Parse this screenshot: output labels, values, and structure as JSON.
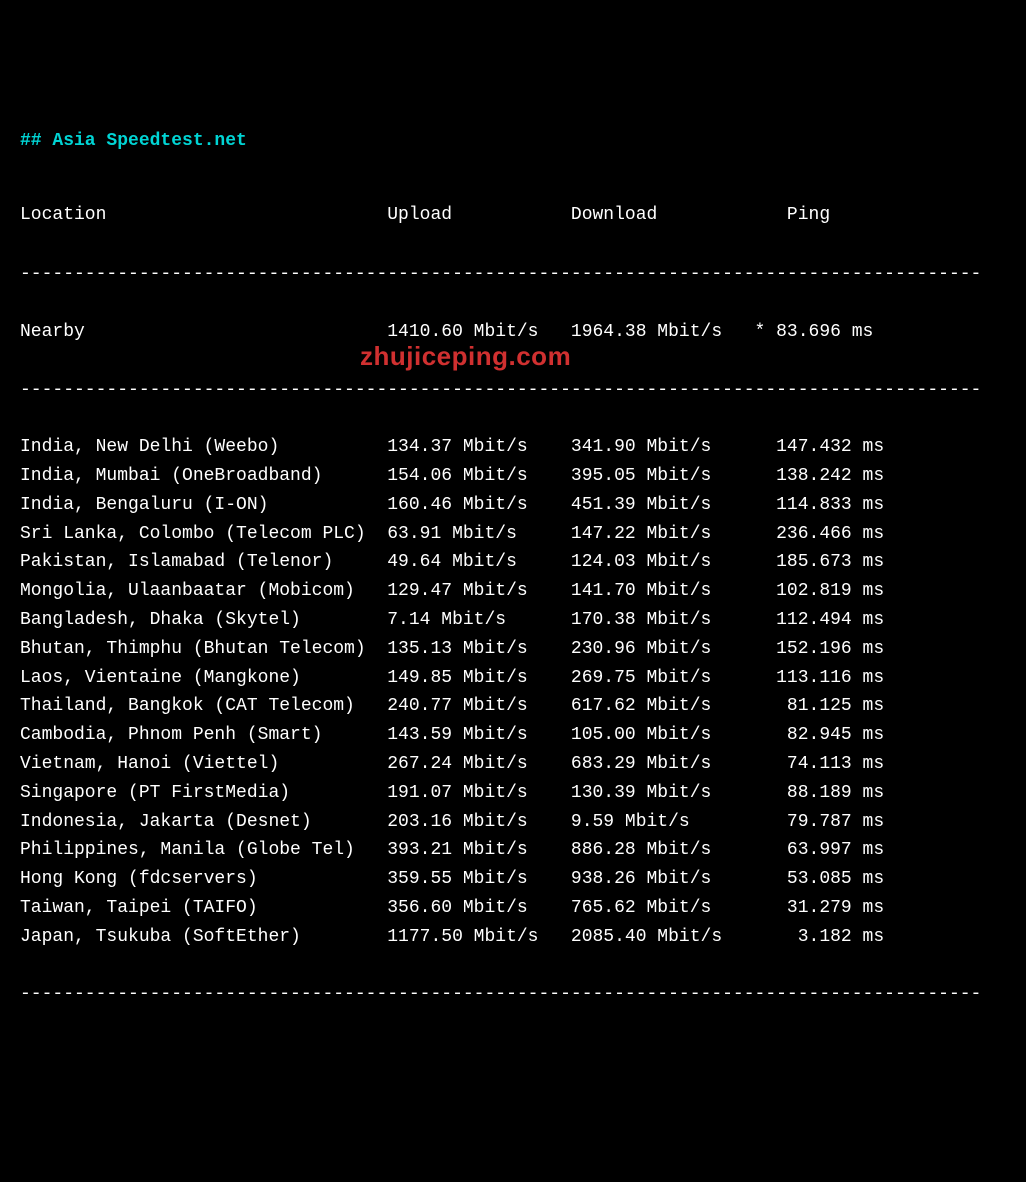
{
  "title": "## Asia Speedtest.net",
  "headers": {
    "location": "Location",
    "upload": "Upload",
    "download": "Download",
    "ping": "Ping"
  },
  "nearby": {
    "location": "Nearby",
    "upload": "1410.60 Mbit/s",
    "download": "1964.38 Mbit/s",
    "ping": "* 83.696 ms"
  },
  "rows": [
    {
      "location": "India, New Delhi (Weebo)",
      "upload": "134.37 Mbit/s",
      "download": "341.90 Mbit/s",
      "ping": "147.432 ms"
    },
    {
      "location": "India, Mumbai (OneBroadband)",
      "upload": "154.06 Mbit/s",
      "download": "395.05 Mbit/s",
      "ping": "138.242 ms"
    },
    {
      "location": "India, Bengaluru (I-ON)",
      "upload": "160.46 Mbit/s",
      "download": "451.39 Mbit/s",
      "ping": "114.833 ms"
    },
    {
      "location": "Sri Lanka, Colombo (Telecom PLC)",
      "upload": "63.91 Mbit/s",
      "download": "147.22 Mbit/s",
      "ping": "236.466 ms"
    },
    {
      "location": "Pakistan, Islamabad (Telenor)",
      "upload": "49.64 Mbit/s",
      "download": "124.03 Mbit/s",
      "ping": "185.673 ms"
    },
    {
      "location": "Mongolia, Ulaanbaatar (Mobicom)",
      "upload": "129.47 Mbit/s",
      "download": "141.70 Mbit/s",
      "ping": "102.819 ms"
    },
    {
      "location": "Bangladesh, Dhaka (Skytel)",
      "upload": "7.14 Mbit/s",
      "download": "170.38 Mbit/s",
      "ping": "112.494 ms"
    },
    {
      "location": "Bhutan, Thimphu (Bhutan Telecom)",
      "upload": "135.13 Mbit/s",
      "download": "230.96 Mbit/s",
      "ping": "152.196 ms"
    },
    {
      "location": "Laos, Vientaine (Mangkone)",
      "upload": "149.85 Mbit/s",
      "download": "269.75 Mbit/s",
      "ping": "113.116 ms"
    },
    {
      "location": "Thailand, Bangkok (CAT Telecom)",
      "upload": "240.77 Mbit/s",
      "download": "617.62 Mbit/s",
      "ping": "81.125 ms"
    },
    {
      "location": "Cambodia, Phnom Penh (Smart)",
      "upload": "143.59 Mbit/s",
      "download": "105.00 Mbit/s",
      "ping": "82.945 ms"
    },
    {
      "location": "Vietnam, Hanoi (Viettel)",
      "upload": "267.24 Mbit/s",
      "download": "683.29 Mbit/s",
      "ping": "74.113 ms"
    },
    {
      "location": "Singapore (PT FirstMedia)",
      "upload": "191.07 Mbit/s",
      "download": "130.39 Mbit/s",
      "ping": "88.189 ms"
    },
    {
      "location": "Indonesia, Jakarta (Desnet)",
      "upload": "203.16 Mbit/s",
      "download": "9.59 Mbit/s",
      "ping": "79.787 ms"
    },
    {
      "location": "Philippines, Manila (Globe Tel)",
      "upload": "393.21 Mbit/s",
      "download": "886.28 Mbit/s",
      "ping": "63.997 ms"
    },
    {
      "location": "Hong Kong (fdcservers)",
      "upload": "359.55 Mbit/s",
      "download": "938.26 Mbit/s",
      "ping": "53.085 ms"
    },
    {
      "location": "Taiwan, Taipei (TAIFO)",
      "upload": "356.60 Mbit/s",
      "download": "765.62 Mbit/s",
      "ping": "31.279 ms"
    },
    {
      "location": "Japan, Tsukuba (SoftEther)",
      "upload": "1177.50 Mbit/s",
      "download": "2085.40 Mbit/s",
      "ping": "3.182 ms"
    }
  ],
  "watermark": "zhujiceping.com",
  "cols": {
    "loc": 33,
    "up": 16,
    "down": 16,
    "ping": 12
  },
  "divider_len": 89
}
